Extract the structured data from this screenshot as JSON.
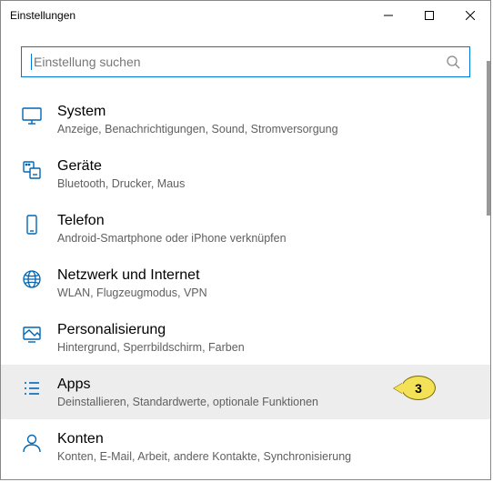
{
  "window": {
    "title": "Einstellungen"
  },
  "search": {
    "placeholder": "Einstellung suchen"
  },
  "items": [
    {
      "title": "System",
      "sub": "Anzeige, Benachrichtigungen, Sound, Stromversorgung"
    },
    {
      "title": "Geräte",
      "sub": "Bluetooth, Drucker, Maus"
    },
    {
      "title": "Telefon",
      "sub": "Android-Smartphone oder iPhone verknüpfen"
    },
    {
      "title": "Netzwerk und Internet",
      "sub": "WLAN, Flugzeugmodus, VPN"
    },
    {
      "title": "Personalisierung",
      "sub": "Hintergrund, Sperrbildschirm, Farben"
    },
    {
      "title": "Apps",
      "sub": "Deinstallieren, Standardwerte, optionale Funktionen"
    },
    {
      "title": "Konten",
      "sub": "Konten, E-Mail, Arbeit, andere Kontakte, Synchronisierung"
    }
  ],
  "callout": {
    "label": "3"
  },
  "colors": {
    "accent": "#0078d7",
    "iconBlue": "#0066b4"
  }
}
